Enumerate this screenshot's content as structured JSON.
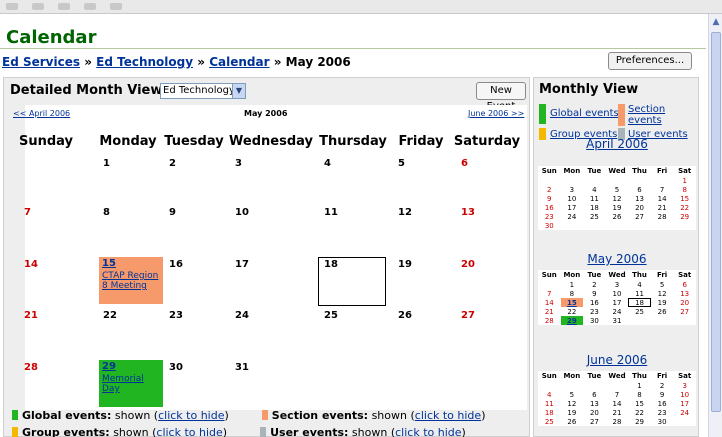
{
  "app": {
    "title": "Calendar"
  },
  "breadcrumb": {
    "items": [
      "Ed Services",
      "Ed Technology",
      "Calendar"
    ],
    "separator": "»",
    "current": "May 2006"
  },
  "preferences_label": "Preferences...",
  "main": {
    "view_label": "Detailed Month View:",
    "course_select": "Ed Technology",
    "new_event_label": "New Event",
    "prev_link": "<< April 2006",
    "month_label": "May 2006",
    "next_link": "June 2006 >>",
    "weekdays": [
      "Sunday",
      "Monday",
      "Tuesday",
      "Wednesday",
      "Thursday",
      "Friday",
      "Saturday"
    ],
    "weeks": [
      [
        "",
        "1",
        "2",
        "3",
        "4",
        "5",
        "6"
      ],
      [
        "7",
        "8",
        "9",
        "10",
        "11",
        "12",
        "13"
      ],
      [
        "14",
        "15",
        "16",
        "17",
        "18",
        "19",
        "20"
      ],
      [
        "21",
        "22",
        "23",
        "24",
        "25",
        "26",
        "27"
      ],
      [
        "28",
        "29",
        "30",
        "31",
        "",
        "",
        ""
      ]
    ],
    "events": {
      "ctap": {
        "day": "15",
        "title": "CTAP Region 8 Meeting",
        "type": "section"
      },
      "memorial": {
        "day": "29",
        "title": "Memorial Day",
        "type": "global"
      }
    },
    "today": "18",
    "legend": {
      "global_label": "Global events:",
      "section_label": "Section events:",
      "group_label": "Group events:",
      "user_label": "User events:",
      "state_text": "shown",
      "toggle_text": "click to hide",
      "open_paren": "(",
      "close_paren": ")"
    }
  },
  "sidebar": {
    "title": "Monthly View",
    "legend": {
      "global": "Global events",
      "section": "Section events",
      "group": "Group events",
      "user": "User events"
    },
    "mini_weekdays": [
      "Sun",
      "Mon",
      "Tue",
      "Wed",
      "Thu",
      "Fri",
      "Sat"
    ],
    "months": [
      {
        "title": "April 2006",
        "weeks": [
          [
            "",
            "",
            "",
            "",
            "",
            "",
            "1"
          ],
          [
            "2",
            "3",
            "4",
            "5",
            "6",
            "7",
            "8"
          ],
          [
            "9",
            "10",
            "11",
            "12",
            "13",
            "14",
            "15"
          ],
          [
            "16",
            "17",
            "18",
            "19",
            "20",
            "21",
            "22"
          ],
          [
            "23",
            "24",
            "25",
            "26",
            "27",
            "28",
            "29"
          ],
          [
            "30",
            "",
            "",
            "",
            "",
            "",
            ""
          ]
        ]
      },
      {
        "title": "May 2006",
        "weeks": [
          [
            "",
            "1",
            "2",
            "3",
            "4",
            "5",
            "6"
          ],
          [
            "7",
            "8",
            "9",
            "10",
            "11",
            "12",
            "13"
          ],
          [
            "14",
            "15",
            "16",
            "17",
            "18",
            "19",
            "20"
          ],
          [
            "21",
            "22",
            "23",
            "24",
            "25",
            "26",
            "27"
          ],
          [
            "28",
            "29",
            "30",
            "31",
            "",
            "",
            ""
          ]
        ]
      },
      {
        "title": "June 2006",
        "weeks": [
          [
            "",
            "",
            "",
            "",
            "1",
            "2",
            "3"
          ],
          [
            "4",
            "5",
            "6",
            "7",
            "8",
            "9",
            "10"
          ],
          [
            "11",
            "12",
            "13",
            "14",
            "15",
            "16",
            "17"
          ],
          [
            "18",
            "19",
            "20",
            "21",
            "22",
            "23",
            "24"
          ],
          [
            "25",
            "26",
            "27",
            "28",
            "29",
            "30",
            ""
          ]
        ]
      }
    ]
  },
  "colors": {
    "title_green": "#006400",
    "link_blue": "#003399",
    "weekend_red": "#cc0000",
    "global_green": "#22b522",
    "section_orange": "#f79a6b",
    "group_yellow": "#f5b800",
    "user_gray": "#a8b4b8"
  }
}
